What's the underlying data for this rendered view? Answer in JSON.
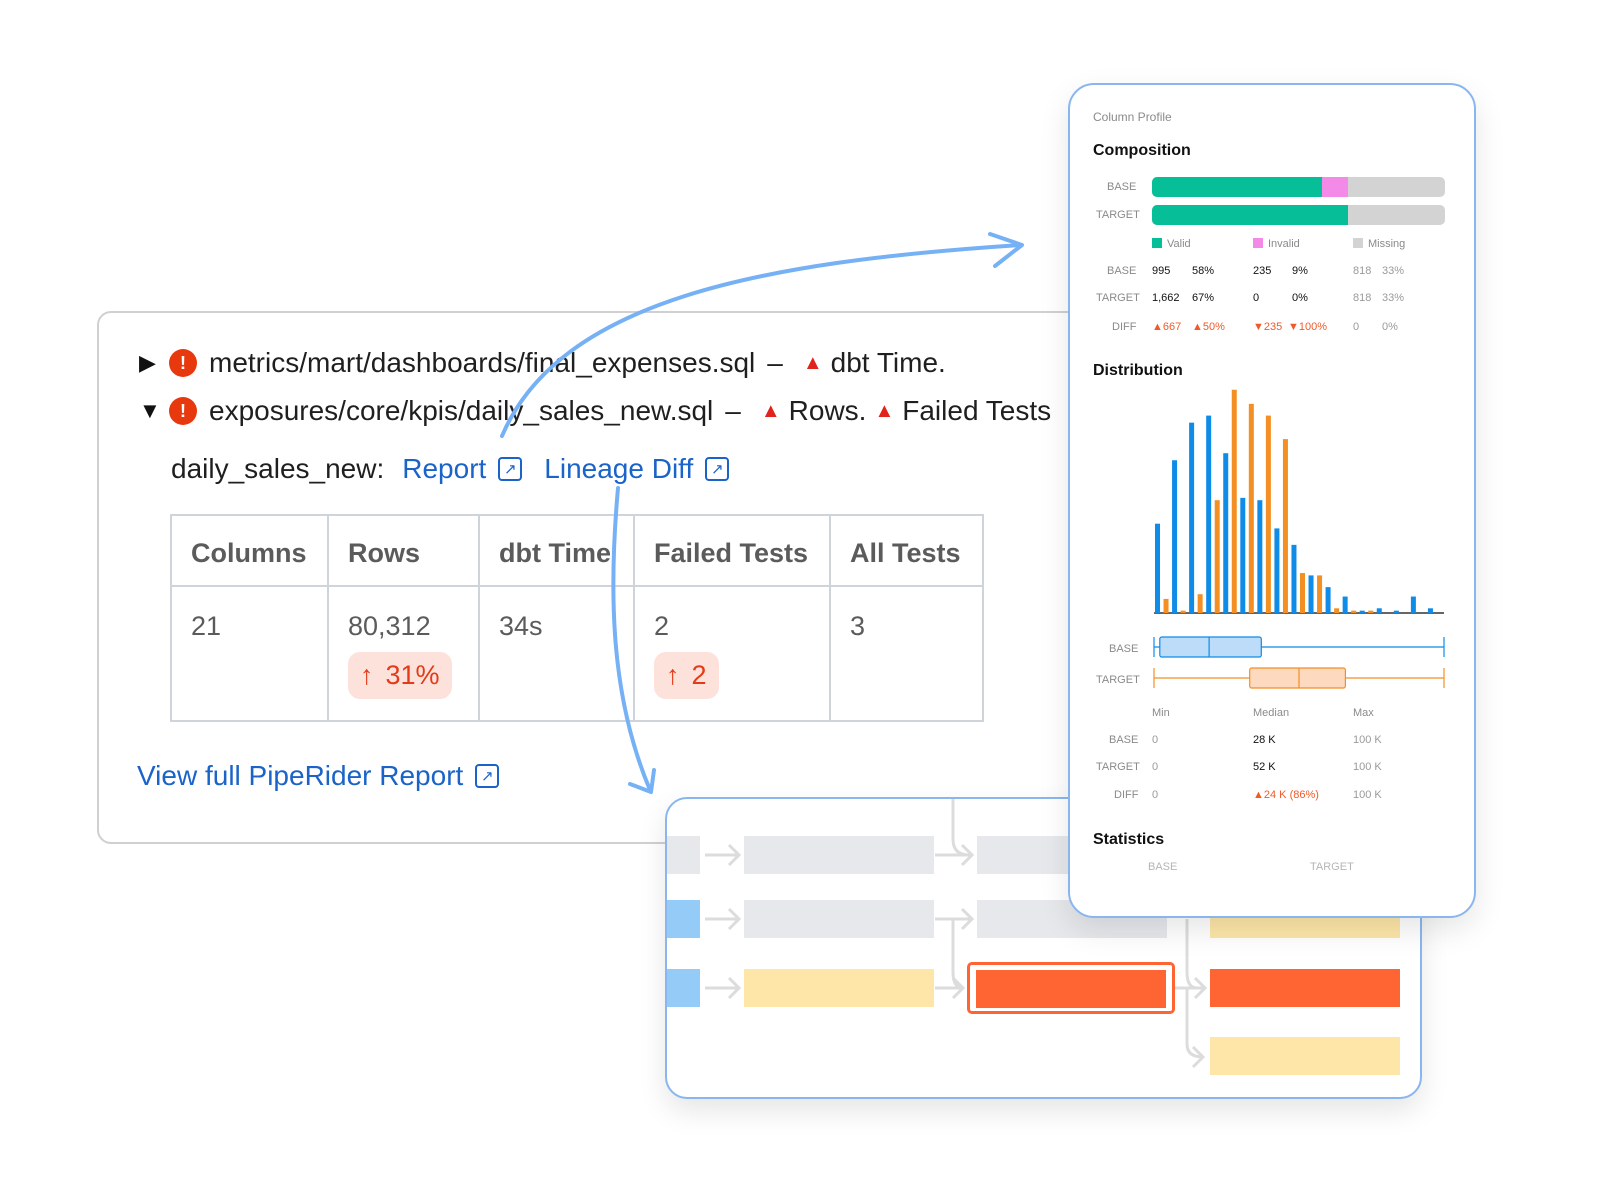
{
  "report": {
    "files": [
      {
        "caret": "▶",
        "path": "metrics/mart/dashboards/final_expenses.sql",
        "separator": "–",
        "changes": [
          "dbt Time."
        ]
      },
      {
        "caret": "▼",
        "path": "exposures/core/kpis/daily_sales_new.sql",
        "separator": "–",
        "changes": [
          "Rows.",
          "Failed Tests"
        ]
      }
    ],
    "model_label": "daily_sales_new:",
    "report_link": "Report",
    "lineage_link": "Lineage Diff",
    "table": {
      "headers": [
        "Columns",
        "Rows",
        "dbt Time",
        "Failed Tests",
        "All Tests"
      ],
      "values": [
        "21",
        "80,312",
        "34s",
        "2",
        "3"
      ],
      "rows_delta": "31%",
      "failed_tests_delta": "2"
    },
    "view_full": "View full PipeRider Report"
  },
  "profile": {
    "title": "Column Profile",
    "composition": {
      "heading": "Composition",
      "row_labels": [
        "BASE",
        "TARGET"
      ],
      "bars": [
        {
          "valid": 58,
          "invalid": 9,
          "missing": 33
        },
        {
          "valid": 67,
          "invalid": 0,
          "missing": 33
        }
      ],
      "legend": [
        "Valid",
        "Invalid",
        "Missing"
      ],
      "table": {
        "labels": [
          "BASE",
          "TARGET",
          "DIFF"
        ],
        "rows": [
          [
            "995",
            "58%",
            "235",
            "9%",
            "818",
            "33%"
          ],
          [
            "1,662",
            "67%",
            "0",
            "0%",
            "818",
            "33%"
          ],
          [
            "▲667",
            "▲50%",
            "▼235",
            "▼100%",
            "0",
            "0%"
          ]
        ]
      }
    },
    "distribution": {
      "heading": "Distribution",
      "row_labels": [
        "BASE",
        "TARGET"
      ],
      "col_labels": [
        "Min",
        "Median",
        "Max"
      ],
      "table_labels": [
        "BASE",
        "TARGET",
        "DIFF"
      ],
      "rows": [
        [
          "0",
          "28 K",
          "100 K"
        ],
        [
          "0",
          "52 K",
          "100 K"
        ],
        [
          "0",
          "▲24 K (86%)",
          "100 K"
        ]
      ]
    },
    "statistics": {
      "heading": "Statistics",
      "cols": [
        "BASE",
        "TARGET"
      ]
    }
  },
  "colors": {
    "valid": "#06bf98",
    "invalid": "#f38ae8",
    "missing": "#d3d3d3",
    "base": "#0f8be8",
    "target": "#f48f24",
    "link": "#1a63c8",
    "alert": "#e8380d",
    "highlight": "#ff6433"
  },
  "chart_data": {
    "type": "bar",
    "series": [
      {
        "values": [
          0.38,
          0.65,
          0.81,
          0.84,
          0.68,
          0.49,
          0.48,
          0.36,
          0.29,
          0.16,
          0.11,
          0.07,
          0.01,
          0.02,
          0.01,
          0.07,
          0.02
        ]
      },
      {
        "values": [
          0.06,
          0.01,
          0.08,
          0.48,
          0.95,
          0.89,
          0.84,
          0.74,
          0.17,
          0.16,
          0.02,
          0.01,
          0.01,
          0.0,
          0.0,
          0.0,
          0.0
        ]
      }
    ],
    "box_base": {
      "min": 0,
      "q1": 0.02,
      "median": 0.19,
      "q3": 0.37,
      "max": 1.0
    },
    "box_target": {
      "min": 0,
      "q1": 0.33,
      "median": 0.5,
      "q3": 0.66,
      "max": 1.0
    }
  }
}
